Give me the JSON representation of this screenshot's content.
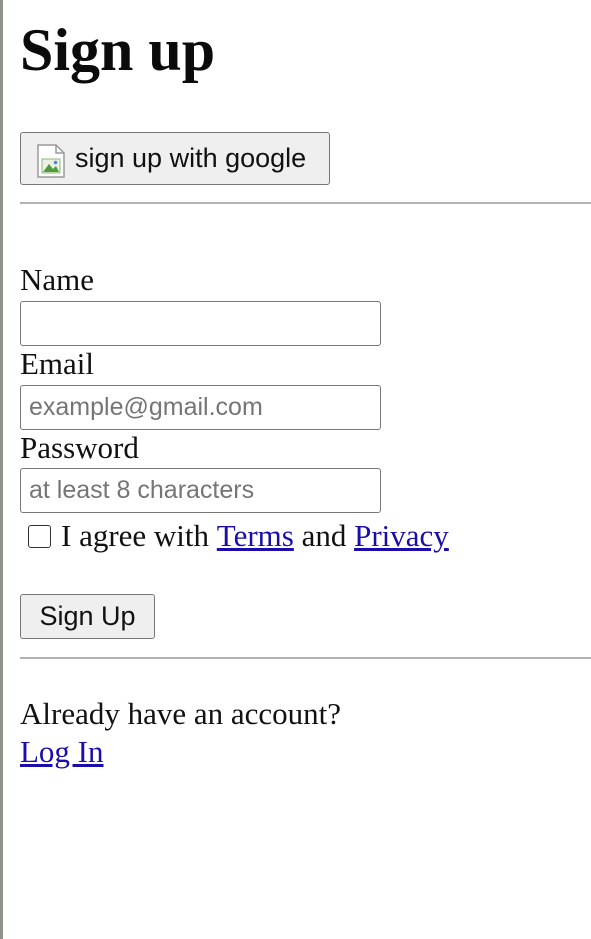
{
  "heading": "Sign up",
  "google_button": {
    "icon": "broken-image-icon",
    "label": "sign up with google"
  },
  "form": {
    "name_label": "Name",
    "name_value": "",
    "email_label": "Email",
    "email_placeholder": "example@gmail.com",
    "password_label": "Password",
    "password_placeholder": "at least 8 characters",
    "agree": {
      "checked": false,
      "text_before": "I agree with ",
      "terms_link": "Terms",
      "and_text": " and ",
      "privacy_link": "Privacy"
    },
    "submit_label": "Sign Up"
  },
  "footer": {
    "prompt": "Already have an account?",
    "login_link": "Log In"
  },
  "colors": {
    "link": "#1a0dab",
    "button_bg": "#efefef",
    "border": "#767676",
    "divider": "#b3b3b3",
    "left_edge": "#8e948a"
  }
}
